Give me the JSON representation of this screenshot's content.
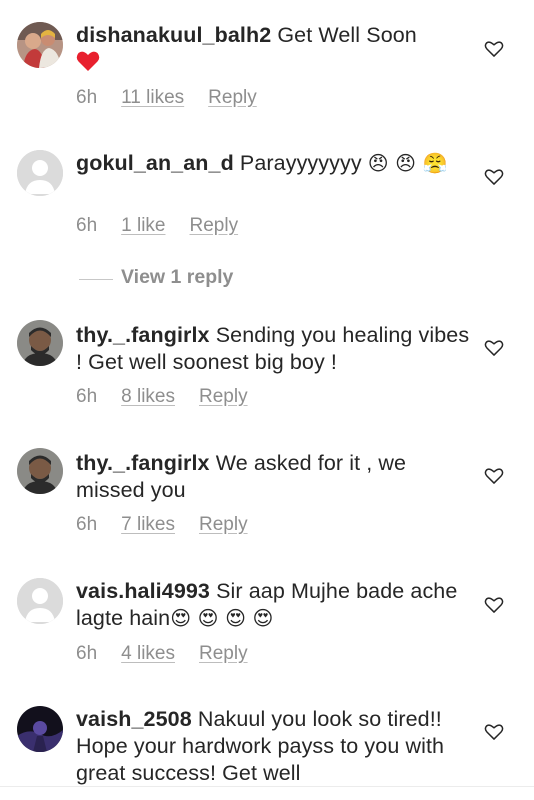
{
  "comments": [
    {
      "username": "dishanakuul_balh2",
      "text": " Get Well Soon",
      "emoji": "❤️",
      "time": "6h",
      "likes": "11 likes",
      "reply": "Reply",
      "avatar": "photo-couple-avatar"
    },
    {
      "username": "gokul_an_an_d",
      "text": " Parayyyyyyy ",
      "emoji": "😠 😠 😤",
      "time": "6h",
      "likes": "1 like",
      "reply": "Reply",
      "avatar": "default-avatar"
    },
    {
      "username": "thy._.fangirlx",
      "text": " Sending you healing vibes ! Get well soonest big boy !",
      "emoji": "",
      "time": "6h",
      "likes": "8 likes",
      "reply": "Reply",
      "avatar": "photo-man-avatar"
    },
    {
      "username": "thy._.fangirlx",
      "text": " We asked for it , we missed you",
      "emoji": "",
      "time": "6h",
      "likes": "7 likes",
      "reply": "Reply",
      "avatar": "photo-man-avatar"
    },
    {
      "username": "vais.hali4993",
      "text": " Sir aap Mujhe bade ache lagte hain",
      "emoji": "😍 😍 😍 😍",
      "time": "6h",
      "likes": "4 likes",
      "reply": "Reply",
      "avatar": "default-avatar"
    },
    {
      "username": "vaish_2508",
      "text": " Nakuul you look so tired!! Hope your hardwork payss to you with great success! Get well",
      "emoji": "",
      "avatar": "photo-dark-avatar"
    }
  ],
  "view_replies_label": "View 1 reply",
  "colors": {
    "text": "#262626",
    "secondary": "#8e8e8e",
    "heart_red": "#e8202e"
  }
}
